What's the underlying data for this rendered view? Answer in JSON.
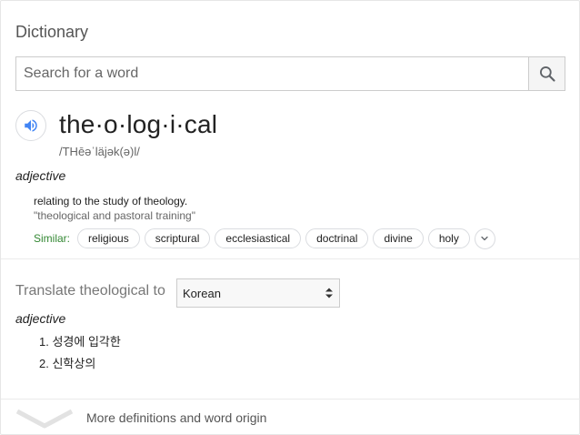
{
  "dictionary": {
    "title": "Dictionary",
    "search": {
      "placeholder": "Search for a word",
      "value": ""
    },
    "entry": {
      "word": "the·o·log·i·cal",
      "phonetic": "/THēəˈläjək(ə)l/",
      "part_of_speech": "adjective",
      "definition": "relating to the study of theology.",
      "example": "\"theological and pastoral training\"",
      "similar_label": "Similar:",
      "similar": [
        "religious",
        "scriptural",
        "ecclesiastical",
        "doctrinal",
        "divine",
        "holy"
      ]
    },
    "translate": {
      "label": "Translate theological to",
      "language": "Korean",
      "part_of_speech": "adjective",
      "items": [
        "1. 성경에 입각한",
        "2. 신학상의"
      ]
    },
    "more_link": "More definitions and word origin"
  },
  "colors": {
    "similar_label": "#338833",
    "speaker_icon": "#4285f4",
    "border": "#dadce0"
  },
  "icons": {
    "search": "search-icon",
    "speaker": "speaker-icon",
    "expand_similar": "chevron-down-icon",
    "select_arrows": "up-down-arrows-icon",
    "more": "chevron-down-icon"
  }
}
